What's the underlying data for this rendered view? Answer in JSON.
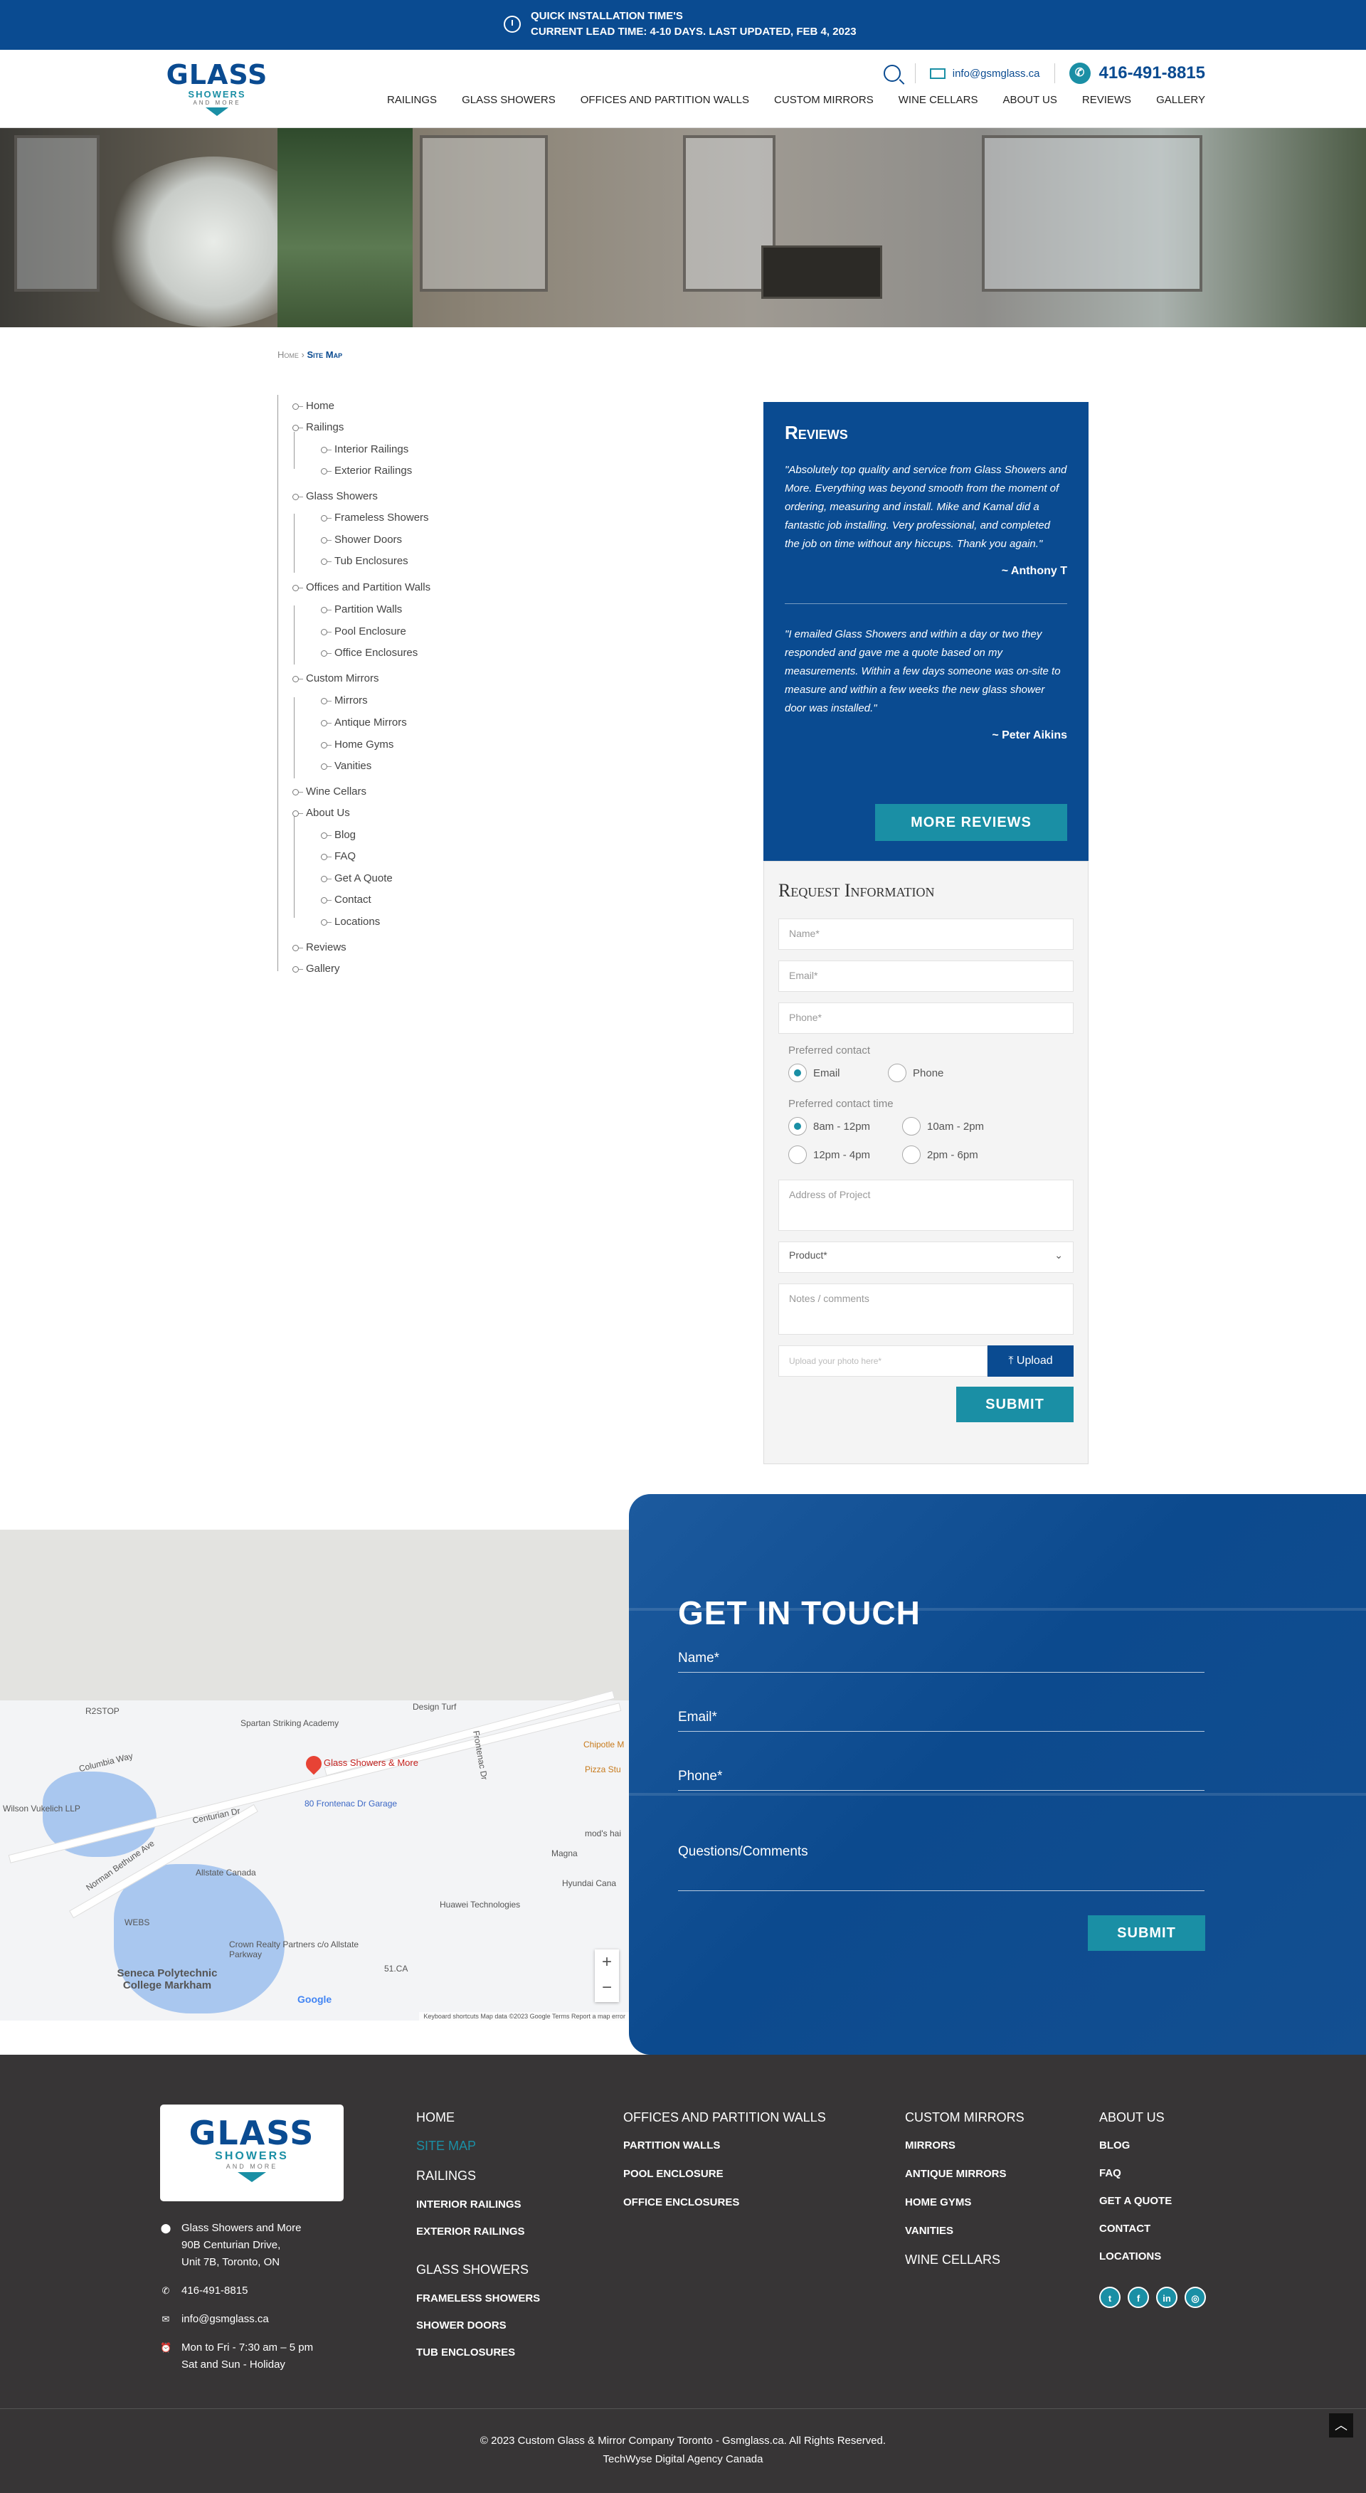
{
  "topbar": {
    "line1": "QUICK INSTALLATION TIME'S",
    "line2": "CURRENT LEAD TIME: 4-10 DAYS. LAST UPDATED, FEB 4, 2023",
    "icon": "clock-icon"
  },
  "header": {
    "logo": {
      "main": "GLASS",
      "sub": "SHOWERS",
      "small": "AND MORE"
    },
    "email": "info@gsmglass.ca",
    "phone": "416-491-8815",
    "nav": [
      "RAILINGS",
      "GLASS SHOWERS",
      "OFFICES AND PARTITION WALLS",
      "CUSTOM MIRRORS",
      "WINE CELLARS",
      "ABOUT US",
      "REVIEWS",
      "GALLERY"
    ]
  },
  "breadcrumb": {
    "home": "Home",
    "sep": "›",
    "current": "Site Map"
  },
  "sitemap": [
    {
      "label": "Home",
      "level": 0
    },
    {
      "label": "Railings",
      "level": 0
    },
    {
      "label": "Interior Railings",
      "level": 1
    },
    {
      "label": "Exterior Railings",
      "level": 1
    },
    {
      "label": "Glass Showers",
      "level": 0
    },
    {
      "label": "Frameless Showers",
      "level": 1
    },
    {
      "label": "Shower Doors",
      "level": 1
    },
    {
      "label": "Tub Enclosures",
      "level": 1
    },
    {
      "label": "Offices and Partition Walls",
      "level": 0
    },
    {
      "label": "Partition Walls",
      "level": 1
    },
    {
      "label": "Pool Enclosure",
      "level": 1
    },
    {
      "label": "Office Enclosures",
      "level": 1
    },
    {
      "label": "Custom Mirrors",
      "level": 0
    },
    {
      "label": "Mirrors",
      "level": 1
    },
    {
      "label": "Antique Mirrors",
      "level": 1
    },
    {
      "label": "Home Gyms",
      "level": 1
    },
    {
      "label": "Vanities",
      "level": 1
    },
    {
      "label": "Wine Cellars",
      "level": 0
    },
    {
      "label": "About Us",
      "level": 0
    },
    {
      "label": "Blog",
      "level": 1
    },
    {
      "label": "FAQ",
      "level": 1
    },
    {
      "label": "Get A Quote",
      "level": 1
    },
    {
      "label": "Contact",
      "level": 1
    },
    {
      "label": "Locations",
      "level": 1
    },
    {
      "label": "Reviews",
      "level": 0
    },
    {
      "label": "Gallery",
      "level": 0
    }
  ],
  "reviews": {
    "title": "Reviews",
    "items": [
      {
        "text": "\"Absolutely top quality and service from Glass Showers and More. Everything was beyond smooth from the moment of ordering, measuring and install. Mike and Kamal did a fantastic job installing. Very professional, and completed the job on time without any hiccups. Thank you again.\"",
        "author": "~ Anthony T"
      },
      {
        "text": "\"I emailed Glass Showers and within a day or two they responded and gave me a quote based on my measurements. Within a few days someone was on-site to measure and within a few weeks the new glass shower door was installed.\"",
        "author": "~ Peter Aikins"
      }
    ],
    "button": "MORE REVIEWS"
  },
  "request": {
    "title": "Request Information",
    "name_ph": "Name*",
    "email_ph": "Email*",
    "phone_ph": "Phone*",
    "contact_label": "Preferred contact",
    "contact_options": [
      {
        "label": "Email",
        "selected": true
      },
      {
        "label": "Phone",
        "selected": false
      }
    ],
    "time_label": "Preferred contact time",
    "time_options": [
      {
        "label": "8am - 12pm",
        "selected": true
      },
      {
        "label": "10am - 2pm",
        "selected": false
      },
      {
        "label": "12pm - 4pm",
        "selected": false
      },
      {
        "label": "2pm - 6pm",
        "selected": false
      }
    ],
    "address_ph": "Address of Project",
    "product": "Product*",
    "notes_ph": "Notes / comments",
    "upload_ph": "Upload your photo here*",
    "upload_btn": "Upload",
    "submit": "SUBMIT"
  },
  "map": {
    "pin_label": "Glass Showers & More",
    "labels": [
      "R2STOP",
      "Spartan Striking Academy",
      "Design Turf",
      "Columbia Way",
      "Centurian Dr",
      "80 Frontenac Dr Garage",
      "Wilson Vukelich LLP",
      "Norman Bethune Ave",
      "Allstate Canada",
      "Huawei Technologies",
      "Magna",
      "Hyundai Cana",
      "Crown Realty Partners c/o Allstate Parkway",
      "WEBS",
      "51.CA",
      "Seneca Polytechnic College Markham",
      "Pizza Stu",
      "Chipotle M",
      "mod's hai",
      "Frontenac Dr"
    ],
    "zoom_in": "+",
    "zoom_out": "−",
    "google": "Google",
    "attribution": "Keyboard shortcuts   Map data ©2023 Google   Terms   Report a map error"
  },
  "touch": {
    "title": "GET IN TOUCH",
    "name": "Name*",
    "email": "Email*",
    "phone": "Phone*",
    "questions": "Questions/Comments",
    "submit": "SUBMIT"
  },
  "footer": {
    "logo": {
      "main": "GLASS",
      "sub": "SHOWERS",
      "small": "AND MORE"
    },
    "address": [
      "Glass Showers and More",
      "90B Centurian Drive,",
      "Unit 7B, Toronto, ON"
    ],
    "phone": "416-491-8815",
    "email": "info@gsmglass.ca",
    "hours": [
      "Mon to Fri - 7:30 am – 5 pm",
      "Sat and Sun - Holiday"
    ],
    "col1": {
      "home": "HOME",
      "sitemap": "SITE MAP",
      "railings": "RAILINGS",
      "rail_links": [
        "INTERIOR RAILINGS",
        "EXTERIOR RAILINGS"
      ],
      "showers": "GLASS SHOWERS",
      "shower_links": [
        "FRAMELESS SHOWERS",
        "SHOWER DOORS",
        "TUB ENCLOSURES"
      ]
    },
    "col2": {
      "head": "OFFICES AND PARTITION WALLS",
      "links": [
        "PARTITION WALLS",
        "POOL ENCLOSURE",
        "OFFICE ENCLOSURES"
      ]
    },
    "col3": {
      "head": "CUSTOM MIRRORS",
      "links": [
        "MIRRORS",
        "ANTIQUE MIRRORS",
        "HOME GYMS",
        "VANITIES"
      ],
      "head2": "WINE CELLARS"
    },
    "col4": {
      "head": "ABOUT US",
      "links": [
        "BLOG",
        "FAQ",
        "GET A QUOTE",
        "CONTACT",
        "LOCATIONS"
      ]
    },
    "social": [
      "twitter-icon",
      "facebook-icon",
      "linkedin-icon",
      "instagram-icon"
    ],
    "copyright": "© 2023 Custom Glass & Mirror Company Toronto - Gsmglass.ca. All Rights Reserved.",
    "agency": "TechWyse Digital Agency Canada"
  },
  "colors": {
    "brand_blue": "#0a4b91",
    "accent_teal": "#1a8fa5",
    "footer_bg": "#373536"
  }
}
